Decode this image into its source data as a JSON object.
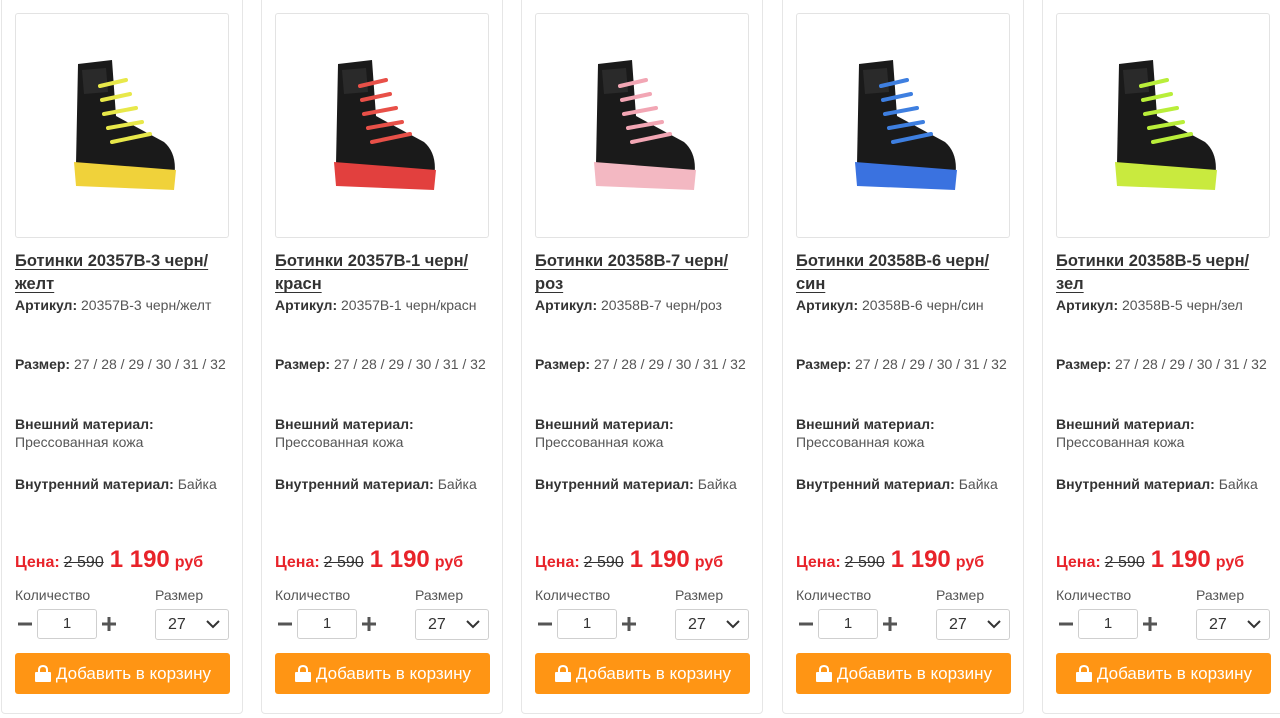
{
  "price_label": "Цена:",
  "currency": "руб",
  "qty_label": "Количество",
  "size_label": "Размер",
  "cart_label": "Добавить в корзину",
  "attr_labels": {
    "article": "Артикул:",
    "size": "Размер:",
    "outer": "Внешний материал:",
    "inner": "Внутренний материал:"
  },
  "colors": {
    "accent": "#ff9514",
    "price": "#e8232a"
  },
  "products": [
    {
      "title": "Ботинки 20357B-3 черн/желт",
      "article": "20357B-3 черн/желт",
      "sizes": "27 / 28 / 29 / 30 / 31 / 32",
      "outer": "Прессованная кожа",
      "inner": "Байка",
      "old_price": "2 590",
      "new_price": "1 190",
      "qty": "1",
      "size_selected": "27",
      "lace_color": "#e8e84a",
      "sole_color": "#f0d23a"
    },
    {
      "title": "Ботинки 20357B-1 черн/красн",
      "article": "20357B-1 черн/красн",
      "sizes": "27 / 28 / 29 / 30 / 31 / 32",
      "outer": "Прессованная кожа",
      "inner": "Байка",
      "old_price": "2 590",
      "new_price": "1 190",
      "qty": "1",
      "size_selected": "27",
      "lace_color": "#e85048",
      "sole_color": "#e2403e"
    },
    {
      "title": "Ботинки 20358B-7 черн/роз",
      "article": "20358B-7 черн/роз",
      "sizes": "27 / 28 / 29 / 30 / 31 / 32",
      "outer": "Прессованная кожа",
      "inner": "Байка",
      "old_price": "2 590",
      "new_price": "1 190",
      "qty": "1",
      "size_selected": "27",
      "lace_color": "#f2a6b4",
      "sole_color": "#f3b8c2"
    },
    {
      "title": "Ботинки 20358B-6 черн/син",
      "article": "20358B-6 черн/син",
      "sizes": "27 / 28 / 29 / 30 / 31 / 32",
      "outer": "Прессованная кожа",
      "inner": "Байка",
      "old_price": "2 590",
      "new_price": "1 190",
      "qty": "1",
      "size_selected": "27",
      "lace_color": "#3e7fe0",
      "sole_color": "#3a72e0"
    },
    {
      "title": "Ботинки 20358B-5 черн/зел",
      "article": "20358B-5 черн/зел",
      "sizes": "27 / 28 / 29 / 30 / 31 / 32",
      "outer": "Прессованная кожа",
      "inner": "Байка",
      "old_price": "2 590",
      "new_price": "1 190",
      "qty": "1",
      "size_selected": "27",
      "lace_color": "#b9ee3a",
      "sole_color": "#c9ea3e"
    }
  ]
}
